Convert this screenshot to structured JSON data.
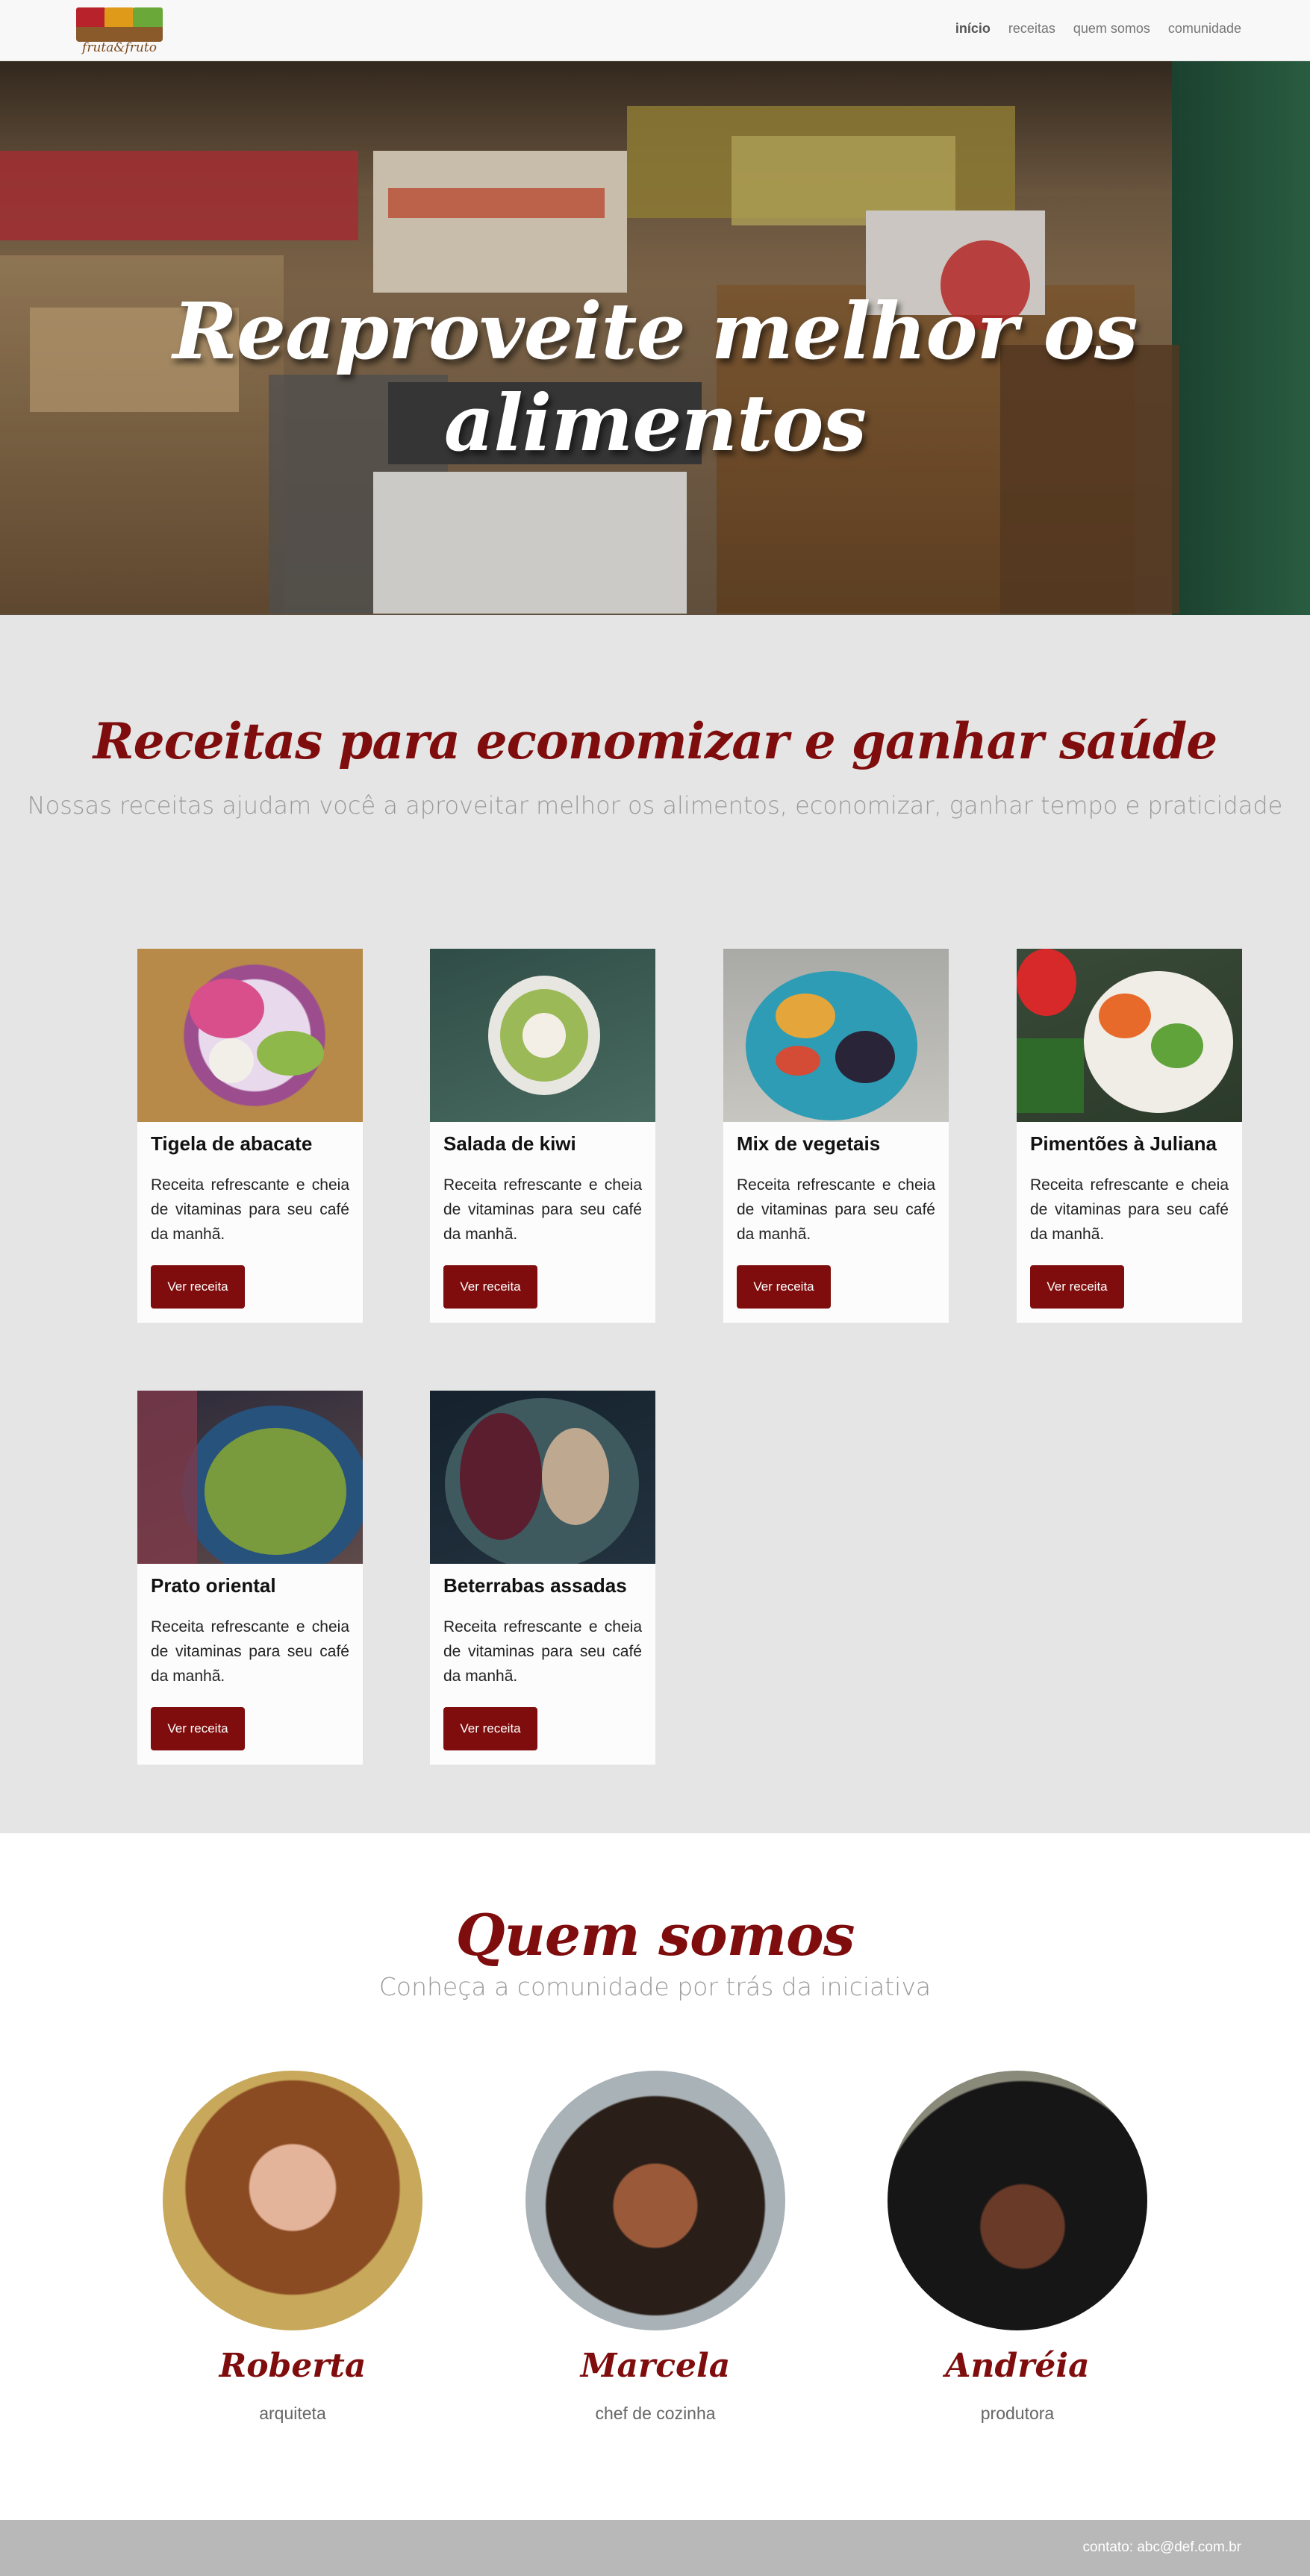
{
  "colors": {
    "accent": "#7f0d0d",
    "recipes_bg": "#e5e5e5",
    "footer_bg": "#b8b8b8",
    "nav_bg": "#f8f8f8"
  },
  "brand": {
    "logo_text": "fruta&fruto"
  },
  "nav": {
    "items": [
      {
        "label": "início",
        "active": true
      },
      {
        "label": "receitas",
        "active": false
      },
      {
        "label": "quem somos",
        "active": false
      },
      {
        "label": "comunidade",
        "active": false
      }
    ]
  },
  "hero": {
    "title": "Reaproveite melhor os alimentos",
    "image": "market-produce-crates-photo"
  },
  "recipes": {
    "title": "Receitas para economizar e ganhar saúde",
    "subtitle": "Nossas receitas ajudam você a aproveitar melhor os alimentos, economizar, ganhar tempo e praticidade",
    "cards": [
      {
        "title": "Tigela de abacate",
        "text": "Receita refrescante e cheia de vitaminas para seu café da manhã.",
        "button": "Ver receita",
        "image": "avocado-bowl-photo"
      },
      {
        "title": "Salada de kiwi",
        "text": "Receita refrescante e cheia de vitaminas para seu café da manhã.",
        "button": "Ver receita",
        "image": "kiwi-bowl-photo"
      },
      {
        "title": "Mix de vegetais",
        "text": "Receita refrescante e cheia de vitaminas para seu café da manhã.",
        "button": "Ver receita",
        "image": "vegetable-plate-photo"
      },
      {
        "title": "Pimentões à Juliana",
        "text": "Receita refrescante e cheia de vitaminas para seu café da manhã.",
        "button": "Ver receita",
        "image": "pepper-salad-photo"
      },
      {
        "title": "Prato oriental",
        "text": "Receita refrescante e cheia de vitaminas para seu café da manhã.",
        "button": "Ver receita",
        "image": "oriental-salad-bowl-photo"
      },
      {
        "title": "Beterrabas assadas",
        "text": "Receita refrescante e cheia de vitaminas para seu café da manhã.",
        "button": "Ver receita",
        "image": "roasted-beets-photo"
      }
    ]
  },
  "about": {
    "title": "Quem somos",
    "subtitle": "Conheça a comunidade por trás da iniciativa",
    "people": [
      {
        "name": "Roberta",
        "role": "arquiteta",
        "image": "woman-curly-hair-portrait"
      },
      {
        "name": "Marcela",
        "role": "chef de cozinha",
        "image": "woman-on-phone-portrait"
      },
      {
        "name": "Andréia",
        "role": "produtora",
        "image": "woman-afro-hair-portrait"
      }
    ]
  },
  "footer": {
    "contact": "contato: abc@def.com.br"
  }
}
